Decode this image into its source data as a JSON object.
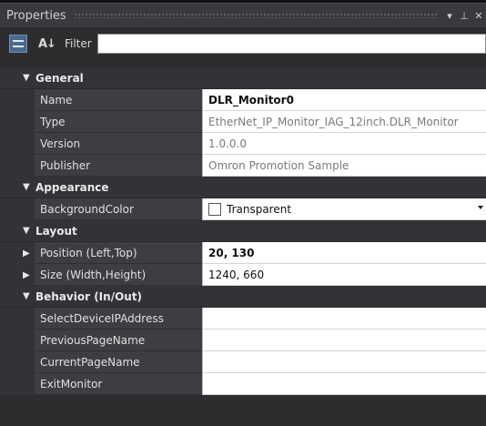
{
  "panel": {
    "title": "Properties"
  },
  "toolbar": {
    "filter_label": "Filter",
    "filter_value": ""
  },
  "categories": {
    "general": {
      "label": "General",
      "props": {
        "name": {
          "label": "Name",
          "value": "DLR_Monitor0"
        },
        "type": {
          "label": "Type",
          "value": "EtherNet_IP_Monitor_IAG_12inch.DLR_Monitor"
        },
        "version": {
          "label": "Version",
          "value": "1.0.0.0"
        },
        "publisher": {
          "label": "Publisher",
          "value": "Omron Promotion Sample"
        }
      }
    },
    "appearance": {
      "label": "Appearance",
      "props": {
        "background": {
          "label": "BackgroundColor",
          "value": "Transparent"
        }
      }
    },
    "layout": {
      "label": "Layout",
      "props": {
        "position": {
          "label": "Position (Left,Top)",
          "value": "20, 130"
        },
        "size": {
          "label": "Size (Width,Height)",
          "value": "1240, 660"
        }
      }
    },
    "behavior": {
      "label": "Behavior (In/Out)",
      "props": {
        "select_ip": {
          "label": "SelectDeviceIPAddress",
          "value": ""
        },
        "previous_page": {
          "label": "PreviousPageName",
          "value": ""
        },
        "current_page": {
          "label": "CurrentPageName",
          "value": ""
        },
        "exit_monitor": {
          "label": "ExitMonitor",
          "value": ""
        }
      }
    }
  },
  "colors": {
    "panel_bg": "#2d2d30",
    "name_cell": "#3e3e42",
    "value_cell": "#ffffff",
    "button_accent": "#4a6a8c"
  },
  "icons": {
    "dropdown": "chevron-down-icon",
    "pin": "pin-icon",
    "close": "close-icon",
    "expanded": "triangle-down-icon",
    "collapsed": "triangle-right-icon"
  }
}
